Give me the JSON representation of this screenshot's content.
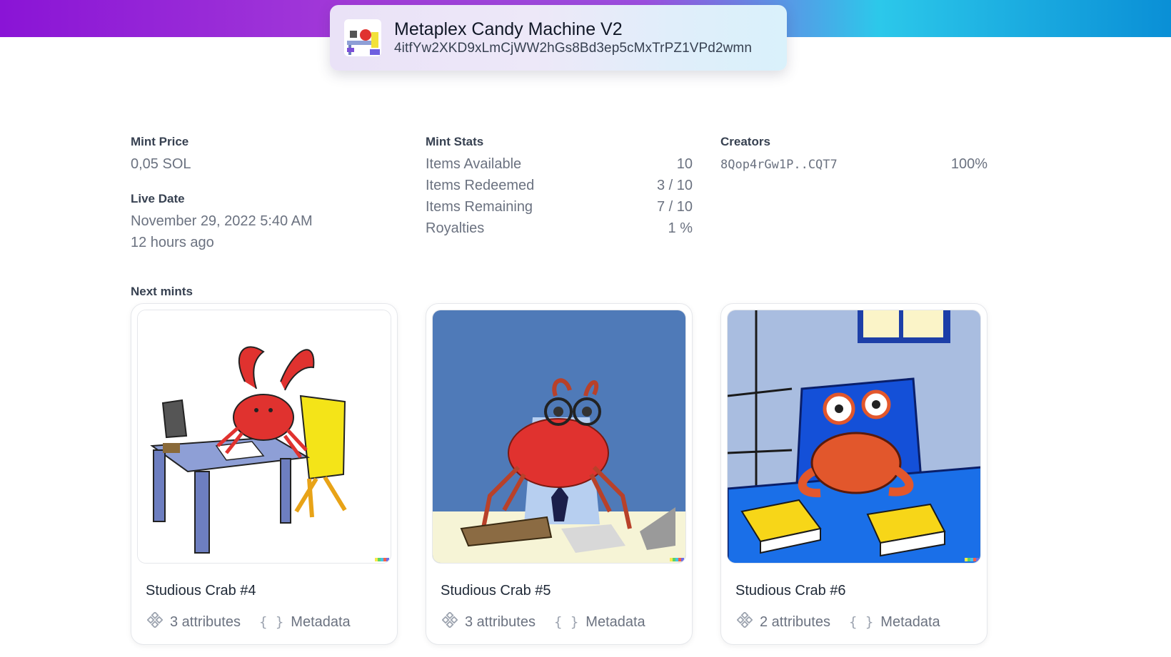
{
  "header": {
    "title": "Metaplex Candy Machine V2",
    "address": "4itfYw2XKD9xLmCjWW2hGs8Bd3ep5cMxTrPZ1VPd2wmn"
  },
  "mint_price": {
    "label": "Mint Price",
    "value": "0,05 SOL"
  },
  "live_date": {
    "label": "Live Date",
    "date": "November 29, 2022 5:40 AM",
    "relative": "12 hours ago"
  },
  "mint_stats": {
    "label": "Mint Stats",
    "rows": [
      {
        "label": "Items Available",
        "value": "10"
      },
      {
        "label": "Items Redeemed",
        "value": "3 / 10"
      },
      {
        "label": "Items Remaining",
        "value": "7 / 10"
      },
      {
        "label": "Royalties",
        "value": "1 %"
      }
    ]
  },
  "creators": {
    "label": "Creators",
    "rows": [
      {
        "address": "8Qop4rGw1P..CQT7",
        "share": "100%"
      }
    ]
  },
  "next_mints": {
    "label": "Next mints",
    "items": [
      {
        "name": "Studious Crab #4",
        "attributes": "3 attributes",
        "metadata": "Metadata",
        "image": "crab-at-desk-white"
      },
      {
        "name": "Studious Crab #5",
        "attributes": "3 attributes",
        "metadata": "Metadata",
        "image": "crab-with-glasses-blue"
      },
      {
        "name": "Studious Crab #6",
        "attributes": "2 attributes",
        "metadata": "Metadata",
        "image": "crab-with-books-blue"
      }
    ]
  },
  "icons": {
    "attributes": "attributes-icon",
    "metadata": "braces-icon"
  }
}
